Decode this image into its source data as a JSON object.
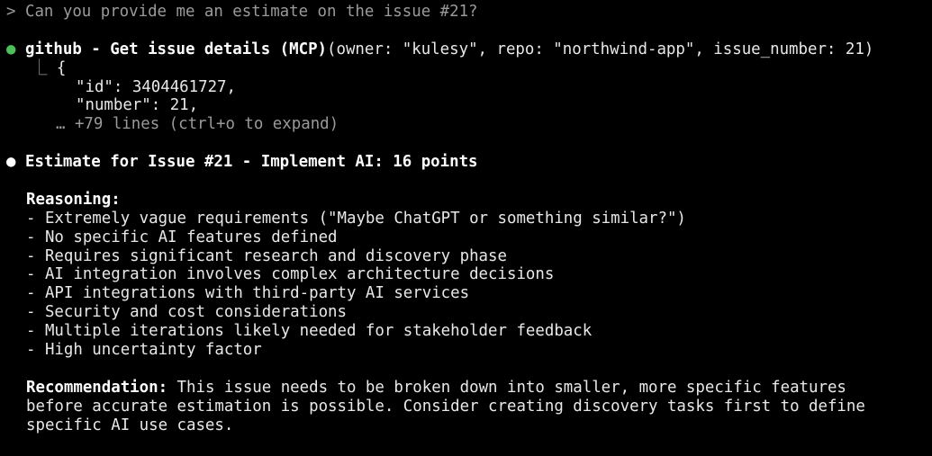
{
  "prompt": {
    "marker": ">",
    "text": "Can you provide me an estimate on the issue #21?"
  },
  "tool_call": {
    "bullet": "●",
    "name": "github - Get issue details (MCP)",
    "args": "(owner: \"kulesy\", repo: \"northwind-app\", issue_number: 21)",
    "result_branch": "⎿",
    "result_open": "{",
    "result_lines": [
      "\"id\": 3404461727,",
      "\"number\": 21,"
    ],
    "collapsed_note": "… +79 lines (ctrl+o to expand)"
  },
  "response": {
    "bullet": "●",
    "heading": "Estimate for Issue #21 - Implement AI: 16 points",
    "reasoning_label": "Reasoning:",
    "reasoning_items": [
      "- Extremely vague requirements (\"Maybe ChatGPT or something similar?\")",
      "- No specific AI features defined",
      "- Requires significant research and discovery phase",
      "- AI integration involves complex architecture decisions",
      "- API integrations with third-party AI services",
      "- Security and cost considerations",
      "- Multiple iterations likely needed for stakeholder feedback",
      "- High uncertainty factor"
    ],
    "recommendation_label": "Recommendation:",
    "recommendation_lines": [
      " This issue needs to be broken down into smaller, more specific features",
      "before accurate estimation is possible. Consider creating discovery tasks first to define",
      "specific AI use cases."
    ]
  },
  "colors": {
    "background": "#000000",
    "text": "#e8e8e8",
    "dim": "#9a9a9a",
    "tool_bullet": "#4ec05a"
  }
}
